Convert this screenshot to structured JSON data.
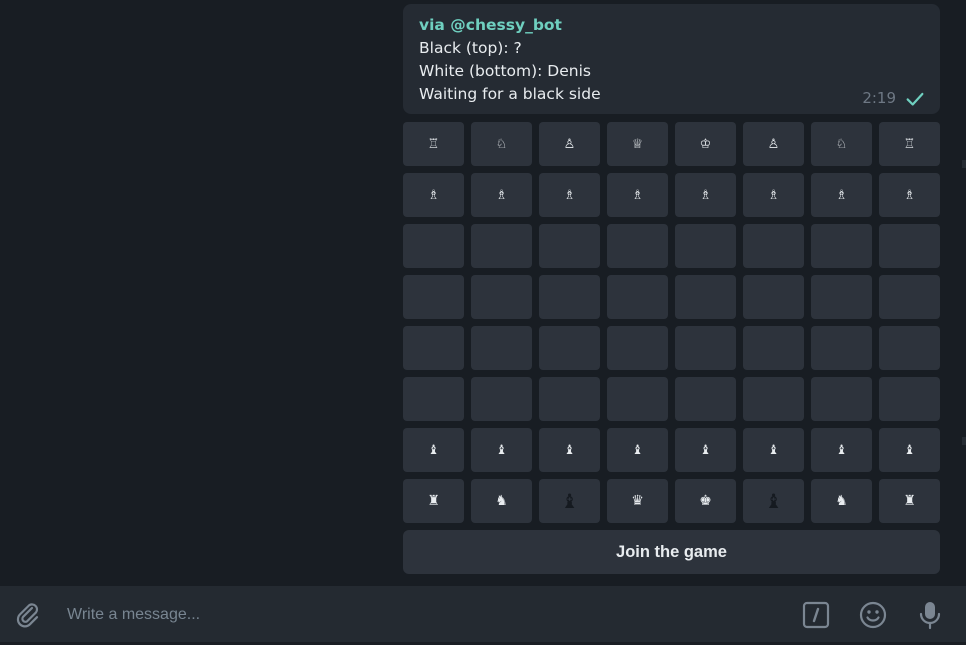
{
  "message": {
    "via": "via @chessy_bot",
    "black_line": "Black (top): ?",
    "white_line": "White (bottom): Denis",
    "status_line": "Waiting for a black side",
    "time": "2:19"
  },
  "board": {
    "rows": [
      [
        "♖",
        "♘",
        "♙",
        "♕",
        "♔",
        "♙",
        "♘",
        "♖"
      ],
      [
        "♗",
        "♗",
        "♗",
        "♗",
        "♗",
        "♗",
        "♗",
        "♗"
      ],
      [
        "",
        "",
        "",
        "",
        "",
        "",
        "",
        ""
      ],
      [
        "",
        "",
        "",
        "",
        "",
        "",
        "",
        ""
      ],
      [
        "",
        "",
        "",
        "",
        "",
        "",
        "",
        ""
      ],
      [
        "",
        "",
        "",
        "",
        "",
        "",
        "",
        ""
      ],
      [
        "♝",
        "♝",
        "♝",
        "♝",
        "♝",
        "♝",
        "♝",
        "♝"
      ],
      [
        "♜",
        "♞",
        "♝",
        "♛",
        "♚",
        "♝",
        "♞",
        "♜"
      ]
    ]
  },
  "join_button": {
    "label": "Join the game"
  },
  "composer": {
    "placeholder": "Write a message..."
  },
  "colors": {
    "accent": "#6fd0c0",
    "background": "#181d23",
    "bubble": "#252b33",
    "cell": "#2d333c"
  },
  "icons": [
    "paperclip-icon",
    "checkmark-icon",
    "slash-command-icon",
    "emoji-icon",
    "microphone-icon"
  ]
}
